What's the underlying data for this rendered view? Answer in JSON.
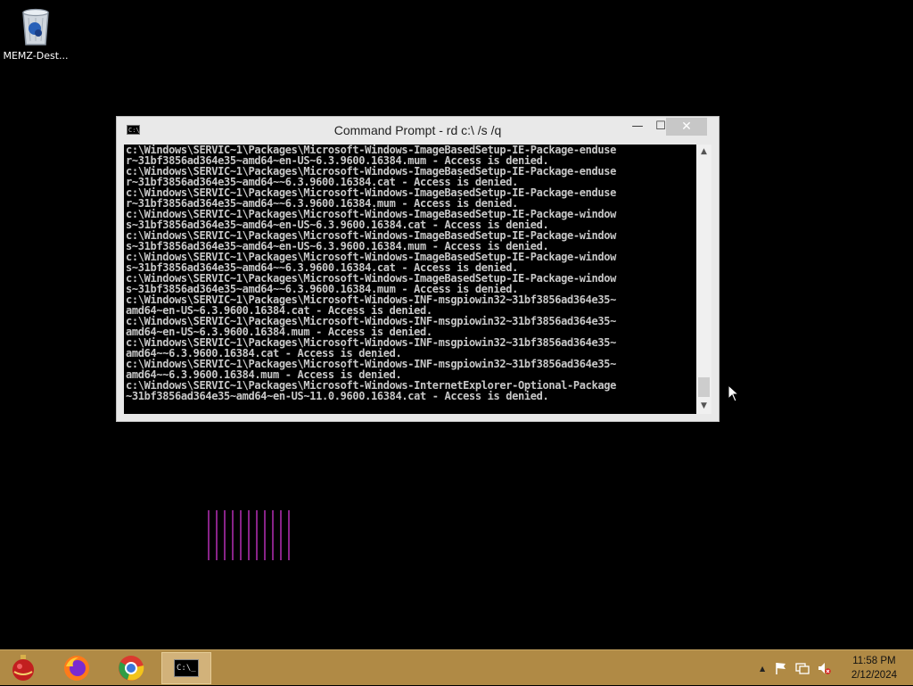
{
  "desktop": {
    "icons": [
      {
        "label": "MEMZ-Dest..."
      }
    ]
  },
  "window": {
    "title": "Command Prompt - rd  c:\\ /s /q",
    "minimize_glyph": "—",
    "maximize_glyph": "☐",
    "close_glyph": "✕",
    "console_lines": [
      "c:\\Windows\\SERVIC~1\\Packages\\Microsoft-Windows-ImageBasedSetup-IE-Package-enduse",
      "r~31bf3856ad364e35~amd64~en-US~6.3.9600.16384.mum - Access is denied.",
      "c:\\Windows\\SERVIC~1\\Packages\\Microsoft-Windows-ImageBasedSetup-IE-Package-enduse",
      "r~31bf3856ad364e35~amd64~~6.3.9600.16384.cat - Access is denied.",
      "c:\\Windows\\SERVIC~1\\Packages\\Microsoft-Windows-ImageBasedSetup-IE-Package-enduse",
      "r~31bf3856ad364e35~amd64~~6.3.9600.16384.mum - Access is denied.",
      "c:\\Windows\\SERVIC~1\\Packages\\Microsoft-Windows-ImageBasedSetup-IE-Package-window",
      "s~31bf3856ad364e35~amd64~en-US~6.3.9600.16384.cat - Access is denied.",
      "c:\\Windows\\SERVIC~1\\Packages\\Microsoft-Windows-ImageBasedSetup-IE-Package-window",
      "s~31bf3856ad364e35~amd64~en-US~6.3.9600.16384.mum - Access is denied.",
      "c:\\Windows\\SERVIC~1\\Packages\\Microsoft-Windows-ImageBasedSetup-IE-Package-window",
      "s~31bf3856ad364e35~amd64~~6.3.9600.16384.cat - Access is denied.",
      "c:\\Windows\\SERVIC~1\\Packages\\Microsoft-Windows-ImageBasedSetup-IE-Package-window",
      "s~31bf3856ad364e35~amd64~~6.3.9600.16384.mum - Access is denied.",
      "c:\\Windows\\SERVIC~1\\Packages\\Microsoft-Windows-INF-msgpiowin32~31bf3856ad364e35~",
      "amd64~en-US~6.3.9600.16384.cat - Access is denied.",
      "c:\\Windows\\SERVIC~1\\Packages\\Microsoft-Windows-INF-msgpiowin32~31bf3856ad364e35~",
      "amd64~en-US~6.3.9600.16384.mum - Access is denied.",
      "c:\\Windows\\SERVIC~1\\Packages\\Microsoft-Windows-INF-msgpiowin32~31bf3856ad364e35~",
      "amd64~~6.3.9600.16384.cat - Access is denied.",
      "c:\\Windows\\SERVIC~1\\Packages\\Microsoft-Windows-INF-msgpiowin32~31bf3856ad364e35~",
      "amd64~~6.3.9600.16384.mum - Access is denied.",
      "c:\\Windows\\SERVIC~1\\Packages\\Microsoft-Windows-InternetExplorer-Optional-Package",
      "~31bf3856ad364e35~amd64~en-US~11.0.9600.16384.cat - Access is denied."
    ]
  },
  "taskbar": {
    "apps": [
      {
        "name": "memz-ornament-icon"
      },
      {
        "name": "firefox-icon"
      },
      {
        "name": "chrome-icon"
      },
      {
        "name": "command-prompt-icon",
        "active": true,
        "glyph": "C:\\_"
      }
    ],
    "tray": {
      "chevron": "▲",
      "time": "11:58 PM",
      "date": "2/12/2024"
    }
  },
  "colors": {
    "taskbar": "#b08a45",
    "console_bg": "#000000",
    "console_text": "#c8c8c8",
    "artifact": "#b52fb5"
  }
}
